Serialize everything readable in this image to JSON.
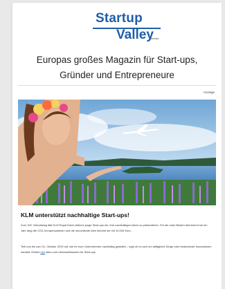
{
  "logo": {
    "line1": "Startup",
    "line2": "Valley",
    "suffix": "media"
  },
  "tagline": {
    "line1": "Europas großes Magazin für Start-ups,",
    "line2": "Gründer und Entrepreneure"
  },
  "ad_label": "Anzeige",
  "article": {
    "title": "KLM unterstützt nachhaltige Start-ups!",
    "paragraph1": "Zum 100. Geburtstag lädt KLM Royal Dutch Airlines junge Start-ups ein, ihre nachhaltigen Ideen zu präsentieren. Für die zehn Besten übernimmt sie ein Jahr lang die CO2-Kompensationen und die innovativste Idee belohnt sie mit 10.000 Euro.",
    "paragraph2_before": "Teilt uns bis zum 31. Oktober 2019 mit, wie ihr euer Unternehmen nachhaltig gestaltet – egal ob es sich um alltägliche Dinge oder bedeutende Innovationen handelt. Erfahrt ",
    "paragraph2_link": "hier",
    "paragraph2_after": " alles zum Ideenwettbewerb für Start-ups."
  },
  "colors": {
    "brand": "#1d5ea8",
    "page_bg": "#e9e9e9",
    "sheet_bg": "#ffffff"
  }
}
